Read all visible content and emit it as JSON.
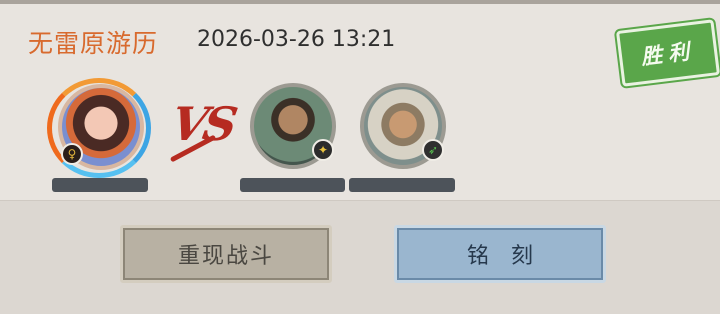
{
  "header": {
    "title": "无雷原游历",
    "datetime": "2026-03-26 13:21",
    "result_stamp": "胜利"
  },
  "battle": {
    "vs_label": "VS",
    "left_team": [
      {
        "avatar_icon": "female-hero-portrait",
        "badge_icon": "venus-icon"
      }
    ],
    "right_team": [
      {
        "avatar_icon": "male-general-portrait",
        "badge_icon": "bird-icon"
      },
      {
        "avatar_icon": "male-general-fur-hat-portrait",
        "badge_icon": "leaf-icon"
      }
    ]
  },
  "actions": {
    "replay_label": "重现战斗",
    "engrave_label": "铭刻"
  },
  "colors": {
    "title": "#d86a2e",
    "stamp": "#5aa64a",
    "vs": "#b62b21",
    "replay_button": "#b8b1a3",
    "engrave_button": "#9ab6cf"
  }
}
